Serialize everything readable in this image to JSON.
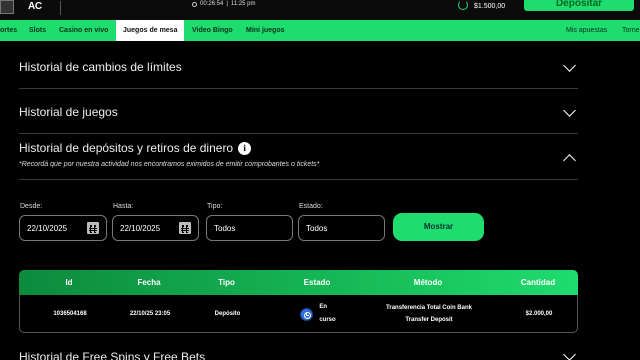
{
  "topbar": {
    "logo": "AC",
    "clock_time": "00:26:54",
    "clock_hour": "11:25 pm",
    "balance": "$1.500,00",
    "deposit_label": "Depositar"
  },
  "nav": {
    "items": [
      "ortes",
      "Slots",
      "Casino en vivo",
      "Juegos de mesa",
      "Video Bingo",
      "Mini juegos"
    ],
    "active_index": 3,
    "right_items": [
      "Mis apuestas",
      "Torne"
    ]
  },
  "sections": {
    "limits": "Historial de cambios de límites",
    "games": "Historial de juegos",
    "deposits": "Historial de depósitos y retiros de dinero",
    "deposits_note": "*Recordá que por nuestra actividad nos encontramos eximidos de emitir comprobantes o tickets*",
    "freespins": "Historial de Free Spins y Free Bets"
  },
  "filters": {
    "from_label": "Desde:",
    "from_value": "22/10/2025",
    "to_label": "Hasta:",
    "to_value": "22/10/2025",
    "type_label": "Tipo:",
    "type_value": "Todos",
    "status_label": "Estado:",
    "status_value": "Todos",
    "show_label": "Mostrar"
  },
  "table": {
    "columns": [
      "Id",
      "Fecha",
      "Tipo",
      "Estado",
      "Método",
      "Cantidad"
    ],
    "rows": [
      {
        "id": "1036504168",
        "date": "22/10/25 23:05",
        "type": "Depósito",
        "status_line1": "En",
        "status_line2": "curso",
        "method_line1": "Transferencia Total Coin Bank",
        "method_line2": "Transfer Deposit",
        "amount": "$2.000,00"
      }
    ]
  },
  "colors": {
    "accent": "#1fdc6f",
    "header_gradient_start": "#0d8a3c",
    "status_icon": "#2f6fd8"
  }
}
